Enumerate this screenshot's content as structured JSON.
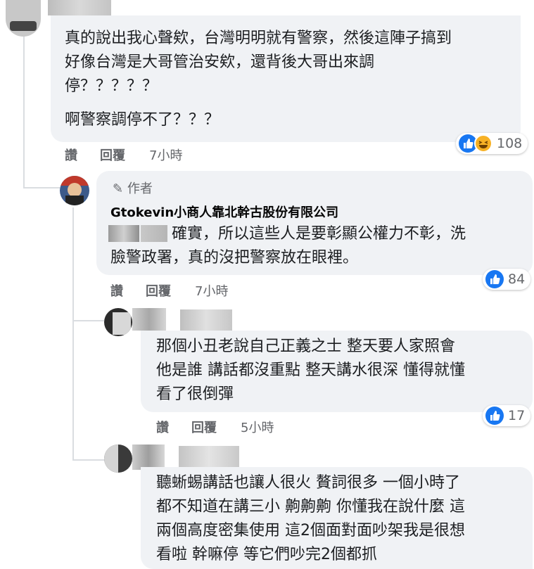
{
  "comments": [
    {
      "lines": [
        "真的說出我心聲欸，台灣明明就有警察，然後這陣子搞到",
        "好像台灣是大哥管治安欸，還背後大哥出來調",
        "停？？？？？"
      ],
      "extra_line": "啊警察調停不了？？？",
      "like_label": "讚",
      "reply_label": "回覆",
      "time": "7小時",
      "reaction_count": "108",
      "reaction_icons": [
        "like-icon",
        "haha-icon"
      ]
    },
    {
      "author_badge": "作者",
      "author_name": "Gtokevin小商人靠北幹古股份有限公司",
      "lines": [
        "確實，所以這些人是要彰顯公權力不彰，洗",
        "臉警政署，真的沒把警察放在眼裡。"
      ],
      "like_label": "讚",
      "reply_label": "回覆",
      "time": "7小時",
      "reaction_count": "84",
      "reaction_icons": [
        "like-icon"
      ]
    },
    {
      "lines": [
        "那個小丑老說自己正義之士 整天要人家照會",
        "他是誰 講話都沒重點 整天講水很深 懂得就懂",
        "看了很倒彈"
      ],
      "like_label": "讚",
      "reply_label": "回覆",
      "time": "5小時",
      "reaction_count": "17",
      "reaction_icons": [
        "like-icon"
      ]
    },
    {
      "lines": [
        "聽蜥蜴講話也讓人很火 贅詞很多 一個小時了",
        "都不知道在講三小 齁齁齁 你懂我在說什麼 這",
        "兩個高度密集使用 這2個面對面吵架我是很想",
        "看啦 幹嘛停 等它們吵完2個都抓"
      ]
    }
  ],
  "colors": {
    "bubble": "#f0f2f5",
    "like_blue": "#1877f2",
    "meta_gray": "#65676b",
    "thread_line": "#dadde1"
  }
}
